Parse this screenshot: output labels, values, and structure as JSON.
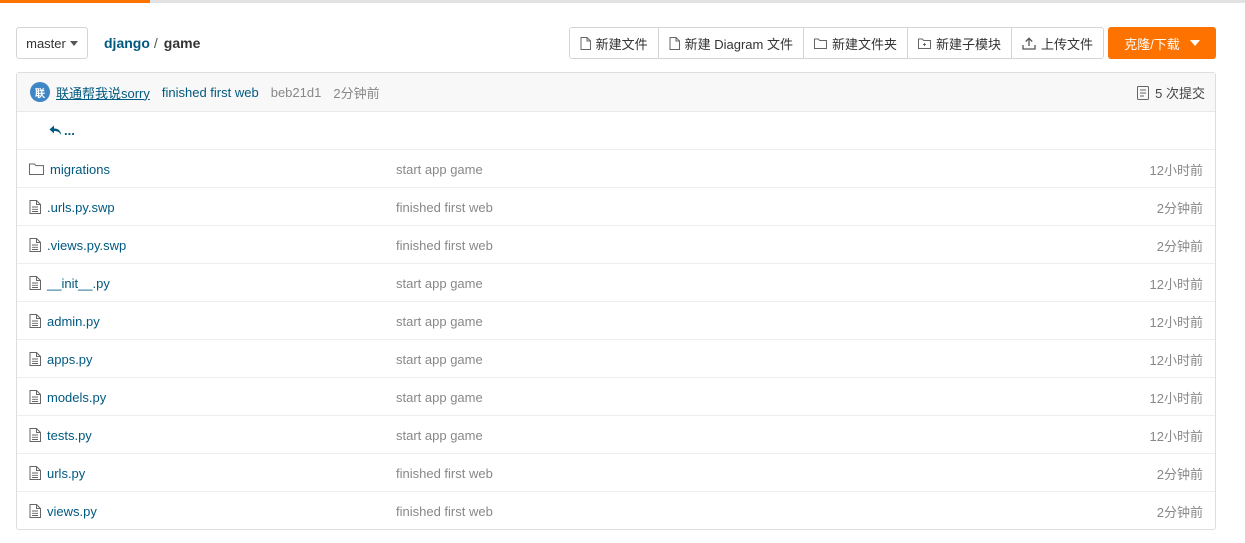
{
  "colors": {
    "accent": "#fe7300",
    "link": "#005980",
    "muted": "#888888",
    "avatar": "#3e86c6"
  },
  "toolbar": {
    "branch": "master",
    "breadcrumb": {
      "repo": "django",
      "separator": "/",
      "current": "game"
    },
    "buttons": {
      "new_file": "新建文件",
      "new_diagram": "新建 Diagram 文件",
      "new_folder": "新建文件夹",
      "new_submodule": "新建子模块",
      "upload": "上传文件"
    },
    "clone": "克隆/下载"
  },
  "commit": {
    "avatar_char": "联",
    "author": "联通帮我说sorry",
    "message": "finished first web",
    "sha": "beb21d1",
    "time": "2分钟前",
    "count": "5 次提交"
  },
  "parent": {
    "label": "..."
  },
  "files": [
    {
      "name": "migrations",
      "type": "folder",
      "message": "start app game",
      "time": "12小时前"
    },
    {
      "name": ".urls.py.swp",
      "type": "file",
      "message": "finished first web",
      "time": "2分钟前"
    },
    {
      "name": ".views.py.swp",
      "type": "file",
      "message": "finished first web",
      "time": "2分钟前"
    },
    {
      "name": "__init__.py",
      "type": "file",
      "message": "start app game",
      "time": "12小时前"
    },
    {
      "name": "admin.py",
      "type": "file",
      "message": "start app game",
      "time": "12小时前"
    },
    {
      "name": "apps.py",
      "type": "file",
      "message": "start app game",
      "time": "12小时前"
    },
    {
      "name": "models.py",
      "type": "file",
      "message": "start app game",
      "time": "12小时前"
    },
    {
      "name": "tests.py",
      "type": "file",
      "message": "start app game",
      "time": "12小时前"
    },
    {
      "name": "urls.py",
      "type": "file",
      "message": "finished first web",
      "time": "2分钟前"
    },
    {
      "name": "views.py",
      "type": "file",
      "message": "finished first web",
      "time": "2分钟前"
    }
  ]
}
